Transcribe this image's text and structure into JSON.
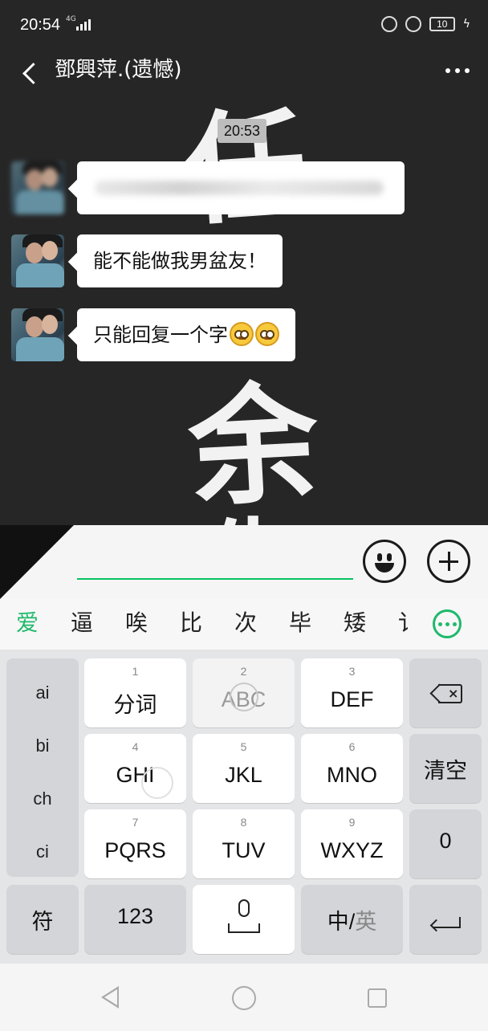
{
  "status_bar": {
    "time": "20:54",
    "network": "4G",
    "battery": "10"
  },
  "header": {
    "title": "鄧興萍.(遗憾)"
  },
  "chat": {
    "background_chars": [
      "任",
      "余",
      "生"
    ],
    "timestamp": "20:53",
    "messages": [
      {
        "text": "",
        "blurred": true
      },
      {
        "text": "能不能做我男盆友！"
      },
      {
        "text": "只能回复一个字",
        "emoji_count": 2,
        "emoji_name": "blush-emoji"
      }
    ]
  },
  "input": {
    "value": ""
  },
  "candidates": {
    "items": [
      "爱",
      "逼",
      "唉",
      "比",
      "次",
      "毕",
      "矮",
      "讠"
    ],
    "active_index": 0
  },
  "keyboard": {
    "pinyin": [
      "ai",
      "bi",
      "ch",
      "ci"
    ],
    "keys": {
      "k1": {
        "num": "1",
        "label": "分词"
      },
      "k2": {
        "num": "2",
        "label": "ABC"
      },
      "k3": {
        "num": "3",
        "label": "DEF"
      },
      "k4": {
        "num": "4",
        "label": "GHI"
      },
      "k5": {
        "num": "5",
        "label": "JKL"
      },
      "k6": {
        "num": "6",
        "label": "MNO"
      },
      "k7": {
        "num": "7",
        "label": "PQRS"
      },
      "k8": {
        "num": "8",
        "label": "TUV"
      },
      "k9": {
        "num": "9",
        "label": "WXYZ"
      },
      "clear": "清空",
      "zero": "0",
      "symbol": "符",
      "num_mode": "123",
      "lang_cn": "中/",
      "lang_en": "英"
    }
  },
  "colors": {
    "accent": "#1fb96b",
    "chat_bg": "#262626",
    "keyboard_bg": "#e4e5e7"
  }
}
